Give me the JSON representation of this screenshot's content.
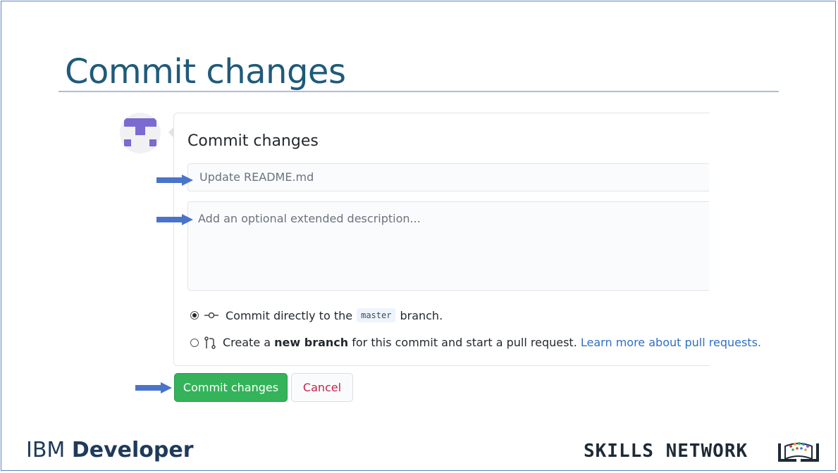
{
  "slide": {
    "title": "Commit changes"
  },
  "panel": {
    "heading": "Commit changes",
    "summary_placeholder": "Update README.md",
    "description_placeholder": "Add an optional extended description...",
    "option_direct": {
      "prefix": "Commit directly to the",
      "branch": "master",
      "suffix": "branch.",
      "selected": true
    },
    "option_new_branch": {
      "prefix": "Create a",
      "bold": "new branch",
      "middle": "for this commit and start a pull request.",
      "link": "Learn more about pull requests.",
      "selected": false
    }
  },
  "buttons": {
    "commit_label": "Commit changes",
    "cancel_label": "Cancel"
  },
  "footer": {
    "brand_prefix": "IBM",
    "brand_suffix": "Developer",
    "network_label": "SKILLS NETWORK"
  },
  "colors": {
    "title": "#1f5a7a",
    "accent_arrow": "#4a74c9",
    "commit_button": "#34b35a",
    "cancel_text": "#c0244a",
    "link": "#2f6fc2"
  },
  "icons": [
    "identicon-avatar",
    "arrow-pointer-icon",
    "commit-icon",
    "pull-request-icon",
    "skills-network-logo"
  ]
}
